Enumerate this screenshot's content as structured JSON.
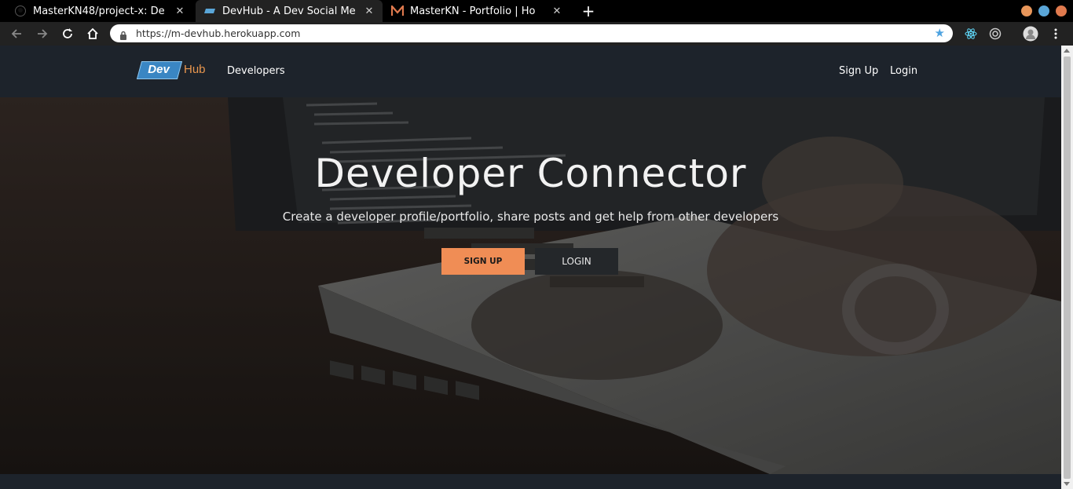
{
  "browser": {
    "tabs": [
      {
        "title": "MasterKN48/project-x: De",
        "icon": "github-icon"
      },
      {
        "title": "DevHub - A Dev Social Me",
        "icon": "devhub-favicon"
      },
      {
        "title": "MasterKN - Portfolio | Ho",
        "icon": "m-favicon"
      }
    ],
    "close_glyph": "✕",
    "new_tab_glyph": "+",
    "url": "https://m-devhub.herokuapp.com",
    "colors": {
      "accent": "#4ea3e0",
      "minimize": "#e8965a",
      "maximize": "#5aa6d8",
      "close": "#e07a4e"
    }
  },
  "navbar": {
    "logo_dev": "Dev",
    "logo_hub": "Hub",
    "developers": "Developers",
    "sign_up": "Sign Up",
    "login": "Login"
  },
  "hero": {
    "title": "Developer Connector",
    "subtitle": "Create a developer profile/portfolio, share posts and get help from other developers",
    "signup_button": "SIGN UP",
    "login_button": "LOGIN",
    "colors": {
      "signup_bg": "#f08d55",
      "login_bg": "#24272a"
    }
  }
}
